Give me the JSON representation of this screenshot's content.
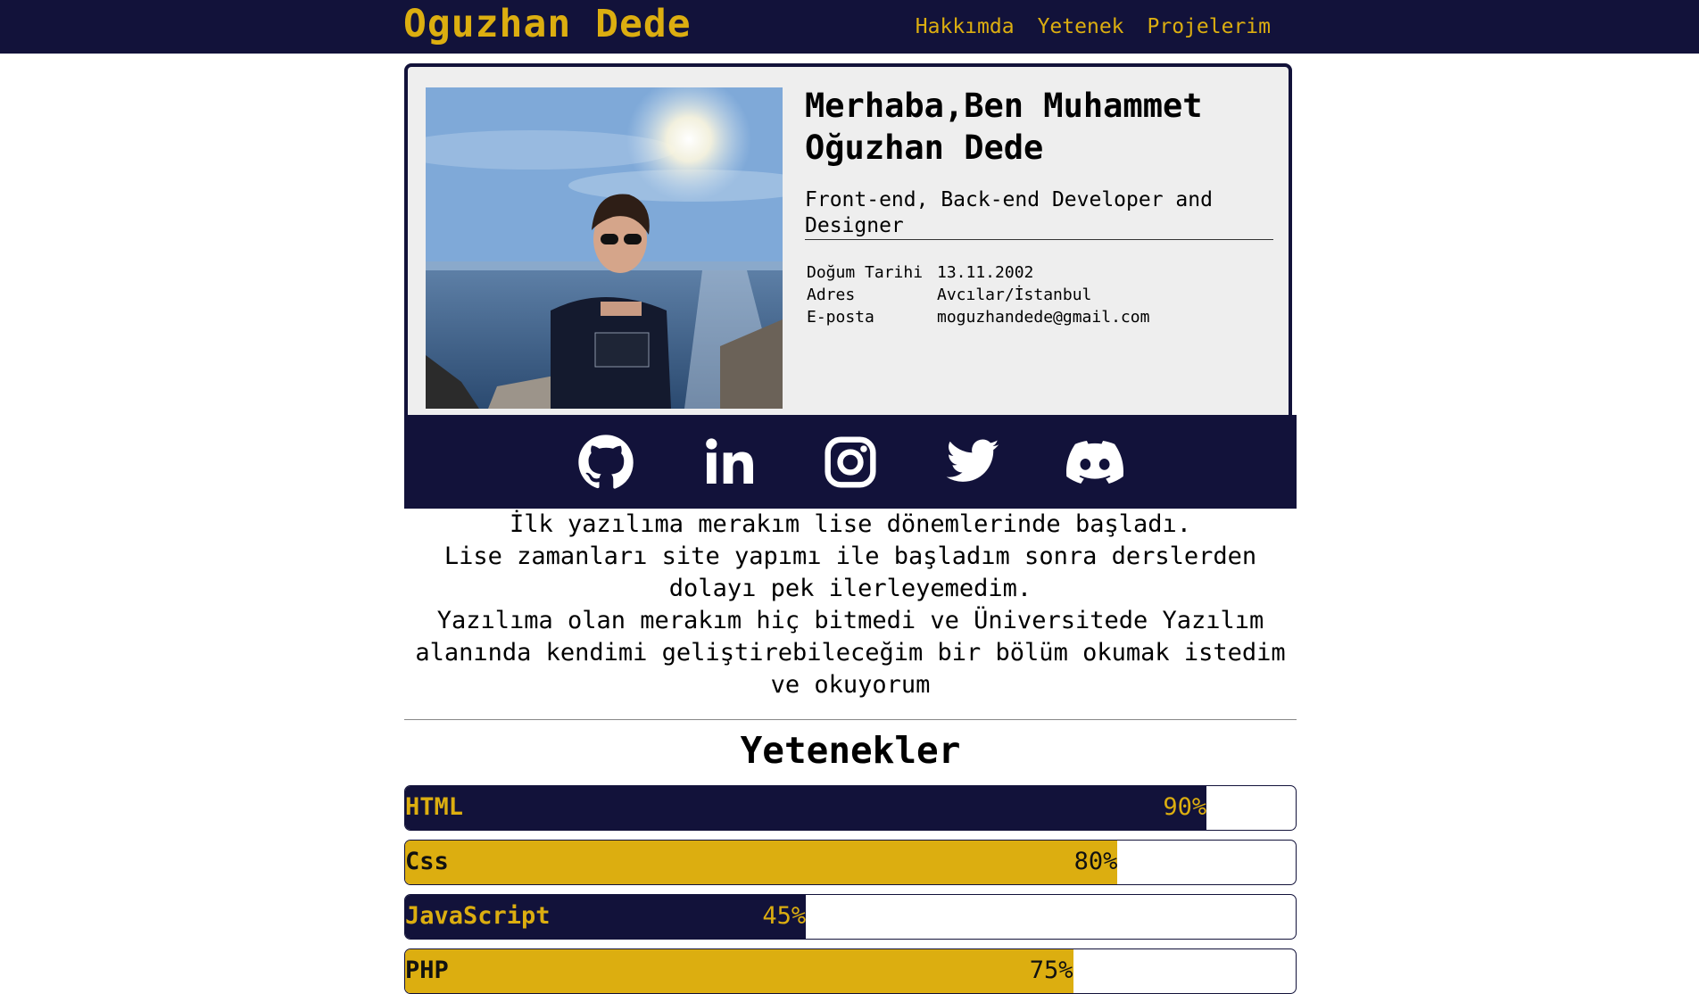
{
  "brand": "Oguzhan Dede",
  "nav": [
    {
      "label": "Hakkımda"
    },
    {
      "label": "Yetenek"
    },
    {
      "label": "Projelerim"
    }
  ],
  "profile": {
    "headline": "Merhaba,Ben Muhammet Oğuzhan Dede",
    "role": "Front-end, Back-end Developer and Designer",
    "info": [
      {
        "label": "Doğum Tarihi",
        "value": "13.11.2002"
      },
      {
        "label": "Adres",
        "value": "Avcılar/İstanbul"
      },
      {
        "label": "E-posta",
        "value": "moguzhandede@gmail.com"
      }
    ]
  },
  "social": [
    "github-icon",
    "linkedin-icon",
    "instagram-icon",
    "twitter-icon",
    "discord-icon"
  ],
  "about": {
    "line1": "İlk yazılıma merakım lise dönemlerinde başladı.",
    "line2": "Lise zamanları site yapımı ile başladım sonra derslerden dolayı pek ilerleyemedim.",
    "line3": "Yazılıma olan merakım hiç bitmedi ve Üniversitede Yazılım alanında kendimi geliştirebileceğim bir bölüm okumak istedim ve okuyorum"
  },
  "skills_title": "Yetenekler",
  "skills": [
    {
      "name": "HTML",
      "percent": "90%",
      "value": 90
    },
    {
      "name": "Css",
      "percent": "80%",
      "value": 80
    },
    {
      "name": "JavaScript",
      "percent": "45%",
      "value": 45
    },
    {
      "name": "PHP",
      "percent": "75%",
      "value": 75
    }
  ],
  "colors": {
    "navy": "#12123a",
    "gold": "#dcae10"
  }
}
